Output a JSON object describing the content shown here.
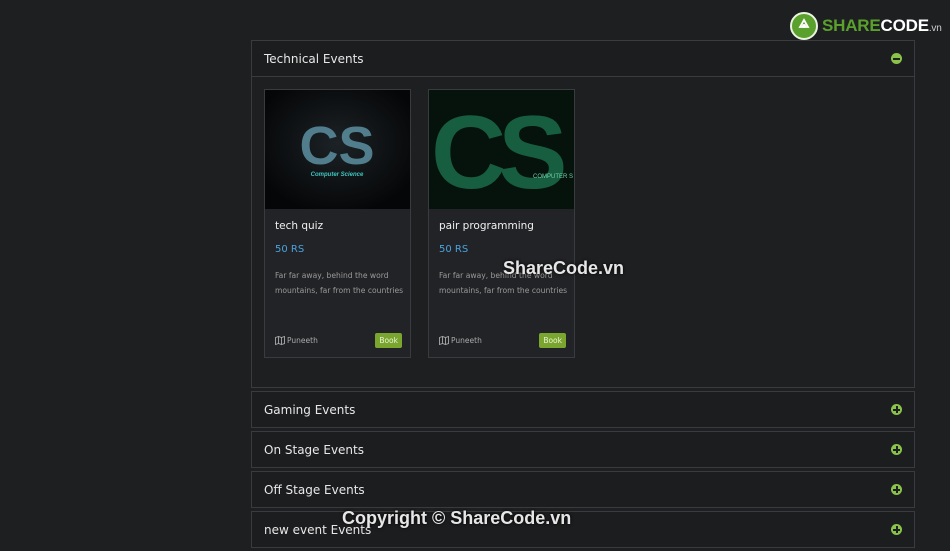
{
  "logo": {
    "share": "SHARE",
    "code": "CODE",
    "vn": ".vn"
  },
  "sections": [
    {
      "title": "Technical Events",
      "expanded": true
    },
    {
      "title": "Gaming Events",
      "expanded": false
    },
    {
      "title": "On Stage Events",
      "expanded": false
    },
    {
      "title": "Off Stage Events",
      "expanded": false
    },
    {
      "title": "new event Events",
      "expanded": false
    }
  ],
  "cards": [
    {
      "image_text": "CS",
      "image_caption": "Computer Science",
      "title": "tech quiz",
      "price": "50 RS",
      "description": "Far far away, behind the word mountains, far from the countries",
      "author": "Puneeth",
      "button": "Book"
    },
    {
      "image_text": "CS",
      "image_caption": "COMPUTER S",
      "title": "pair programming",
      "price": "50 RS",
      "description": "Far far away, behind the word mountains, far from the countries",
      "author": "Puneeth",
      "button": "Book"
    }
  ],
  "watermarks": {
    "center": "ShareCode.vn",
    "bottom": "Copyright © ShareCode.vn"
  },
  "colors": {
    "accent_green": "#8bc34a",
    "price_blue": "#4aa3df",
    "button_green": "#7aa62f"
  }
}
